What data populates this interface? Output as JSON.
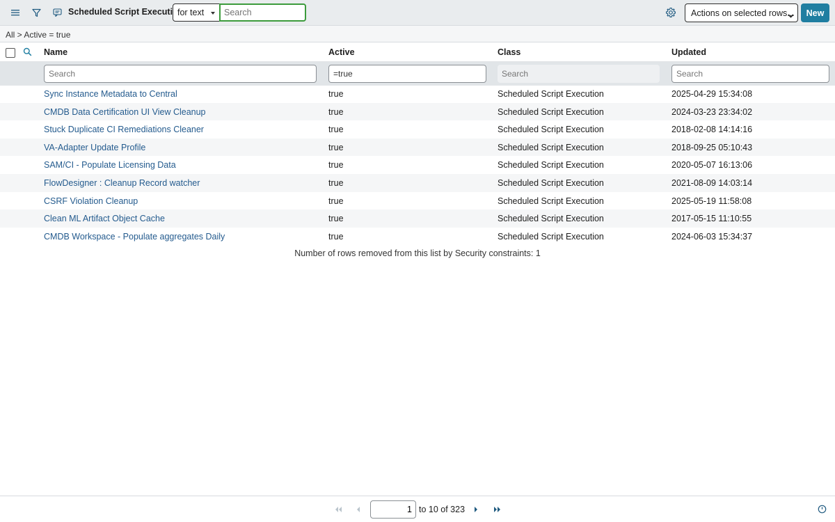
{
  "header": {
    "title": "Scheduled Script Executions",
    "search_mode": "for text",
    "search_placeholder": "Search",
    "actions_label": "Actions on selected rows...",
    "new_label": "New"
  },
  "breadcrumb": "All > Active = true",
  "columns": [
    "Name",
    "Active",
    "Class",
    "Updated"
  ],
  "filters": {
    "name": {
      "value": "",
      "placeholder": "Search"
    },
    "active": {
      "value": "=true",
      "placeholder": ""
    },
    "class": {
      "value": "",
      "placeholder": "Search"
    },
    "updated": {
      "value": "",
      "placeholder": "Search"
    }
  },
  "rows": [
    {
      "name": "Sync Instance Metadata to Central",
      "active": "true",
      "class": "Scheduled Script Execution",
      "updated": "2025-04-29 15:34:08"
    },
    {
      "name": "CMDB Data Certification UI View Cleanup",
      "active": "true",
      "class": "Scheduled Script Execution",
      "updated": "2024-03-23 23:34:02"
    },
    {
      "name": "Stuck Duplicate CI Remediations Cleaner",
      "active": "true",
      "class": "Scheduled Script Execution",
      "updated": "2018-02-08 14:14:16"
    },
    {
      "name": "VA-Adapter Update Profile",
      "active": "true",
      "class": "Scheduled Script Execution",
      "updated": "2018-09-25 05:10:43"
    },
    {
      "name": "SAM/CI - Populate Licensing Data",
      "active": "true",
      "class": "Scheduled Script Execution",
      "updated": "2020-05-07 16:13:06"
    },
    {
      "name": "FlowDesigner : Cleanup Record watcher",
      "active": "true",
      "class": "Scheduled Script Execution",
      "updated": "2021-08-09 14:03:14"
    },
    {
      "name": "CSRF Violation Cleanup",
      "active": "true",
      "class": "Scheduled Script Execution",
      "updated": "2025-05-19 11:58:08"
    },
    {
      "name": "Clean ML Artifact Object Cache",
      "active": "true",
      "class": "Scheduled Script Execution",
      "updated": "2017-05-15 11:10:55"
    },
    {
      "name": "CMDB Workspace - Populate aggregates Daily",
      "active": "true",
      "class": "Scheduled Script Execution",
      "updated": "2024-06-03 15:34:37"
    }
  ],
  "security_note": "Number of rows removed from this list by Security constraints: 1",
  "pagination": {
    "page_value": "1",
    "range_text": "to 10 of 323"
  },
  "colors": {
    "link": "#245b8e",
    "primary_button": "#1f7ea1",
    "search_focus": "#3c9b3c"
  },
  "icons": [
    "menu-icon",
    "filter-icon",
    "list-context-icon",
    "gear-icon",
    "column-search-icon",
    "first-page-icon",
    "previous-page-icon",
    "next-page-icon",
    "last-page-icon",
    "clock-icon"
  ]
}
